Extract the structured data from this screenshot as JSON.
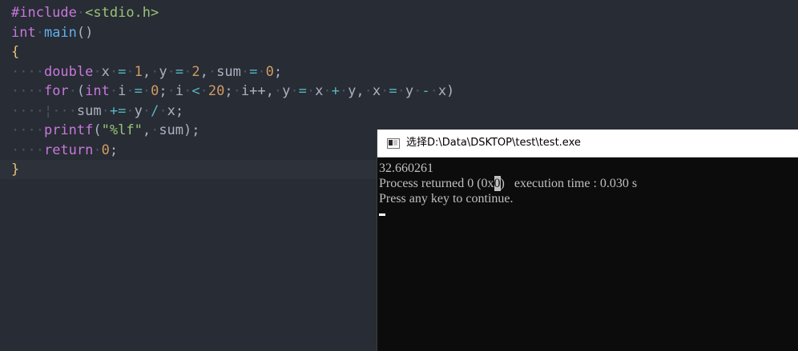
{
  "editor": {
    "lines": [
      {
        "tokens": [
          [
            "kw",
            "#include"
          ],
          [
            "dot",
            "·"
          ],
          [
            "str",
            "<stdio.h>"
          ]
        ]
      },
      {
        "tokens": [
          [
            "kw",
            "int"
          ],
          [
            "dot",
            "·"
          ],
          [
            "fn",
            "main"
          ],
          [
            "plain",
            "()"
          ]
        ]
      },
      {
        "tokens": [
          [
            "br",
            "{"
          ]
        ]
      },
      {
        "tokens": [
          [
            "dot",
            "····"
          ],
          [
            "kw",
            "double"
          ],
          [
            "dot",
            "·"
          ],
          [
            "plain",
            "x"
          ],
          [
            "dot",
            "·"
          ],
          [
            "op",
            "="
          ],
          [
            "dot",
            "·"
          ],
          [
            "num",
            "1"
          ],
          [
            "plain",
            ","
          ],
          [
            "dot",
            "·"
          ],
          [
            "plain",
            "y"
          ],
          [
            "dot",
            "·"
          ],
          [
            "op",
            "="
          ],
          [
            "dot",
            "·"
          ],
          [
            "num",
            "2"
          ],
          [
            "plain",
            ","
          ],
          [
            "dot",
            "·"
          ],
          [
            "plain",
            "sum"
          ],
          [
            "dot",
            "·"
          ],
          [
            "op",
            "="
          ],
          [
            "dot",
            "·"
          ],
          [
            "num",
            "0"
          ],
          [
            "plain",
            ";"
          ]
        ]
      },
      {
        "tokens": [
          [
            "dot",
            "····"
          ],
          [
            "kw",
            "for"
          ],
          [
            "dot",
            "·"
          ],
          [
            "plain",
            "("
          ],
          [
            "kw",
            "int"
          ],
          [
            "dot",
            "·"
          ],
          [
            "plain",
            "i"
          ],
          [
            "dot",
            "·"
          ],
          [
            "op",
            "="
          ],
          [
            "dot",
            "·"
          ],
          [
            "num",
            "0"
          ],
          [
            "plain",
            ";"
          ],
          [
            "dot",
            "·"
          ],
          [
            "plain",
            "i"
          ],
          [
            "dot",
            "·"
          ],
          [
            "op",
            "<"
          ],
          [
            "dot",
            "·"
          ],
          [
            "num",
            "20"
          ],
          [
            "plain",
            ";"
          ],
          [
            "dot",
            "·"
          ],
          [
            "plain",
            "i++,"
          ],
          [
            "dot",
            "·"
          ],
          [
            "plain",
            "y"
          ],
          [
            "dot",
            "·"
          ],
          [
            "op",
            "="
          ],
          [
            "dot",
            "·"
          ],
          [
            "plain",
            "x"
          ],
          [
            "dot",
            "·"
          ],
          [
            "op",
            "+"
          ],
          [
            "dot",
            "·"
          ],
          [
            "plain",
            "y,"
          ],
          [
            "dot",
            "·"
          ],
          [
            "plain",
            "x"
          ],
          [
            "dot",
            "·"
          ],
          [
            "op",
            "="
          ],
          [
            "dot",
            "·"
          ],
          [
            "plain",
            "y"
          ],
          [
            "dot",
            "·"
          ],
          [
            "op",
            "-"
          ],
          [
            "dot",
            "·"
          ],
          [
            "plain",
            "x)"
          ]
        ]
      },
      {
        "tokens": [
          [
            "dot",
            "····"
          ],
          [
            "guide",
            "¦"
          ],
          [
            "dot",
            "···"
          ],
          [
            "plain",
            "sum"
          ],
          [
            "dot",
            "·"
          ],
          [
            "op",
            "+="
          ],
          [
            "dot",
            "·"
          ],
          [
            "plain",
            "y"
          ],
          [
            "dot",
            "·"
          ],
          [
            "op",
            "/"
          ],
          [
            "dot",
            "·"
          ],
          [
            "plain",
            "x;"
          ]
        ]
      },
      {
        "tokens": [
          [
            "dot",
            "····"
          ],
          [
            "kw",
            "printf"
          ],
          [
            "plain",
            "("
          ],
          [
            "str",
            "\"%lf\""
          ],
          [
            "plain",
            ","
          ],
          [
            "dot",
            "·"
          ],
          [
            "plain",
            "sum);"
          ]
        ]
      },
      {
        "tokens": [
          [
            "dot",
            "····"
          ],
          [
            "kw",
            "return"
          ],
          [
            "dot",
            "·"
          ],
          [
            "num",
            "0"
          ],
          [
            "plain",
            ";"
          ]
        ]
      },
      {
        "tokens": [
          [
            "br",
            "}"
          ]
        ],
        "current": true
      }
    ]
  },
  "console": {
    "title": "选择D:\\Data\\DSKTOP\\test\\test.exe",
    "output_line1": "32.660261",
    "output_line2_pre": "Process returned 0 (0x",
    "output_line2_cursor": "0",
    "output_line2_post": ")   execution time : 0.030 s",
    "output_line3": "Press any key to continue."
  }
}
